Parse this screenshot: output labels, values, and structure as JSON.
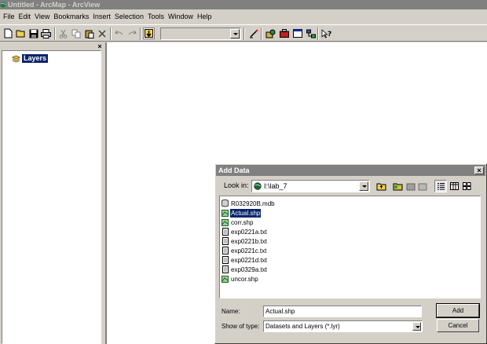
{
  "window": {
    "title": "Untitled - ArcMap - ArcView"
  },
  "menus": [
    "File",
    "Edit",
    "View",
    "Bookmarks",
    "Insert",
    "Selection",
    "Tools",
    "Window",
    "Help"
  ],
  "toc": {
    "root_label": "Layers"
  },
  "dialog": {
    "title": "Add Data",
    "look_in_label": "Look in:",
    "look_in_value": "I:\\lab_7",
    "files": [
      {
        "name": "R032920B.mdb",
        "kind": "geodatabase",
        "selected": false
      },
      {
        "name": "Actual.shp",
        "kind": "shapefile",
        "selected": true
      },
      {
        "name": "corr.shp",
        "kind": "shapefile",
        "selected": false
      },
      {
        "name": "exp0221a.txt",
        "kind": "text",
        "selected": false
      },
      {
        "name": "exp0221b.txt",
        "kind": "text",
        "selected": false
      },
      {
        "name": "exp0221c.txt",
        "kind": "text",
        "selected": false
      },
      {
        "name": "exp0221d.txt",
        "kind": "text",
        "selected": false
      },
      {
        "name": "exp0329a.txt",
        "kind": "text",
        "selected": false
      },
      {
        "name": "uncor.shp",
        "kind": "shapefile",
        "selected": false
      }
    ],
    "name_label": "Name:",
    "name_value": "Actual.shp",
    "type_label": "Show of type:",
    "type_value": "Datasets and Layers (*.lyr)",
    "add_label": "Add",
    "cancel_label": "Cancel"
  },
  "colors": {
    "selection": "#0a246a",
    "titlebar_inactive": "#808080",
    "face": "#d4d0c8"
  }
}
